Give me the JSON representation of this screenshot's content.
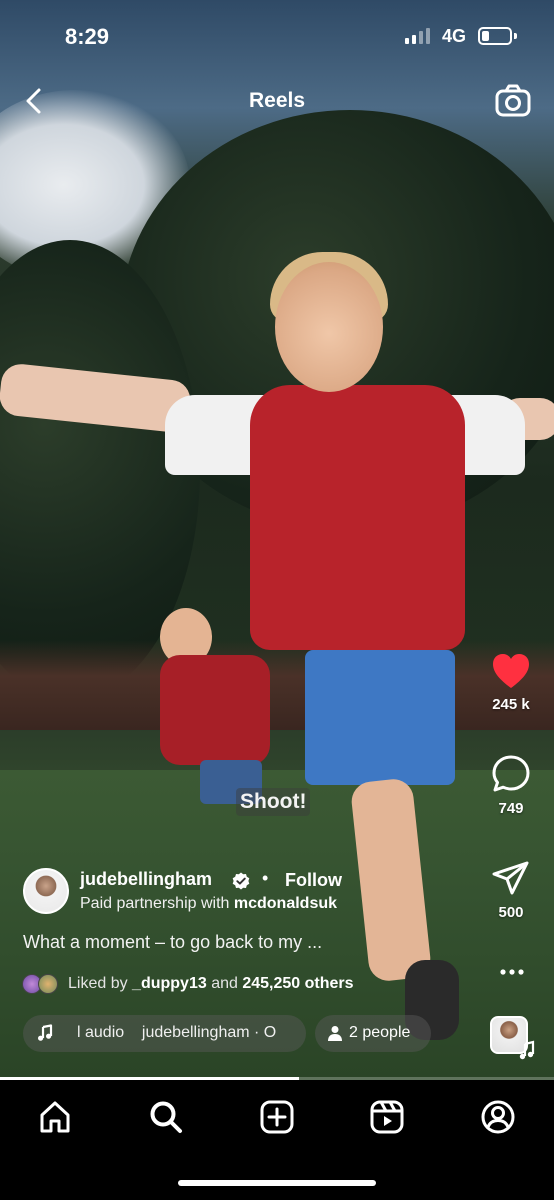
{
  "status_bar": {
    "time": "8:29",
    "network": "4G",
    "battery_level_fraction": 0.25
  },
  "header": {
    "title": "Reels",
    "back_icon": "chevron-left-icon",
    "camera_icon": "camera-icon"
  },
  "video": {
    "caption_overlay": "Shoot!",
    "progress_fraction": 0.54
  },
  "actions": {
    "like_count": "245 k",
    "like_liked": true,
    "like_color": "#ff3040",
    "comment_count": "749",
    "share_count": "500",
    "more_icon": "more-dots-icon"
  },
  "author": {
    "username": "judebellingham",
    "verified": true,
    "separator": "•",
    "follow_label": "Follow",
    "partnership_prefix": "Paid partnership with",
    "partner": "mcdonaldsuk"
  },
  "description": "What a moment – to go back to my ...",
  "likes": {
    "prefix": "Liked by",
    "first_user": "_duppy13",
    "middle": "and",
    "others": "245,250 others"
  },
  "audio": {
    "text": "l audio    judebellingham · O"
  },
  "people": {
    "label": "2 people"
  },
  "tabs": [
    {
      "name": "home",
      "icon": "home-icon"
    },
    {
      "name": "search",
      "icon": "search-icon"
    },
    {
      "name": "create",
      "icon": "plus-square-icon"
    },
    {
      "name": "reels",
      "icon": "reels-icon"
    },
    {
      "name": "profile",
      "icon": "profile-icon"
    }
  ]
}
